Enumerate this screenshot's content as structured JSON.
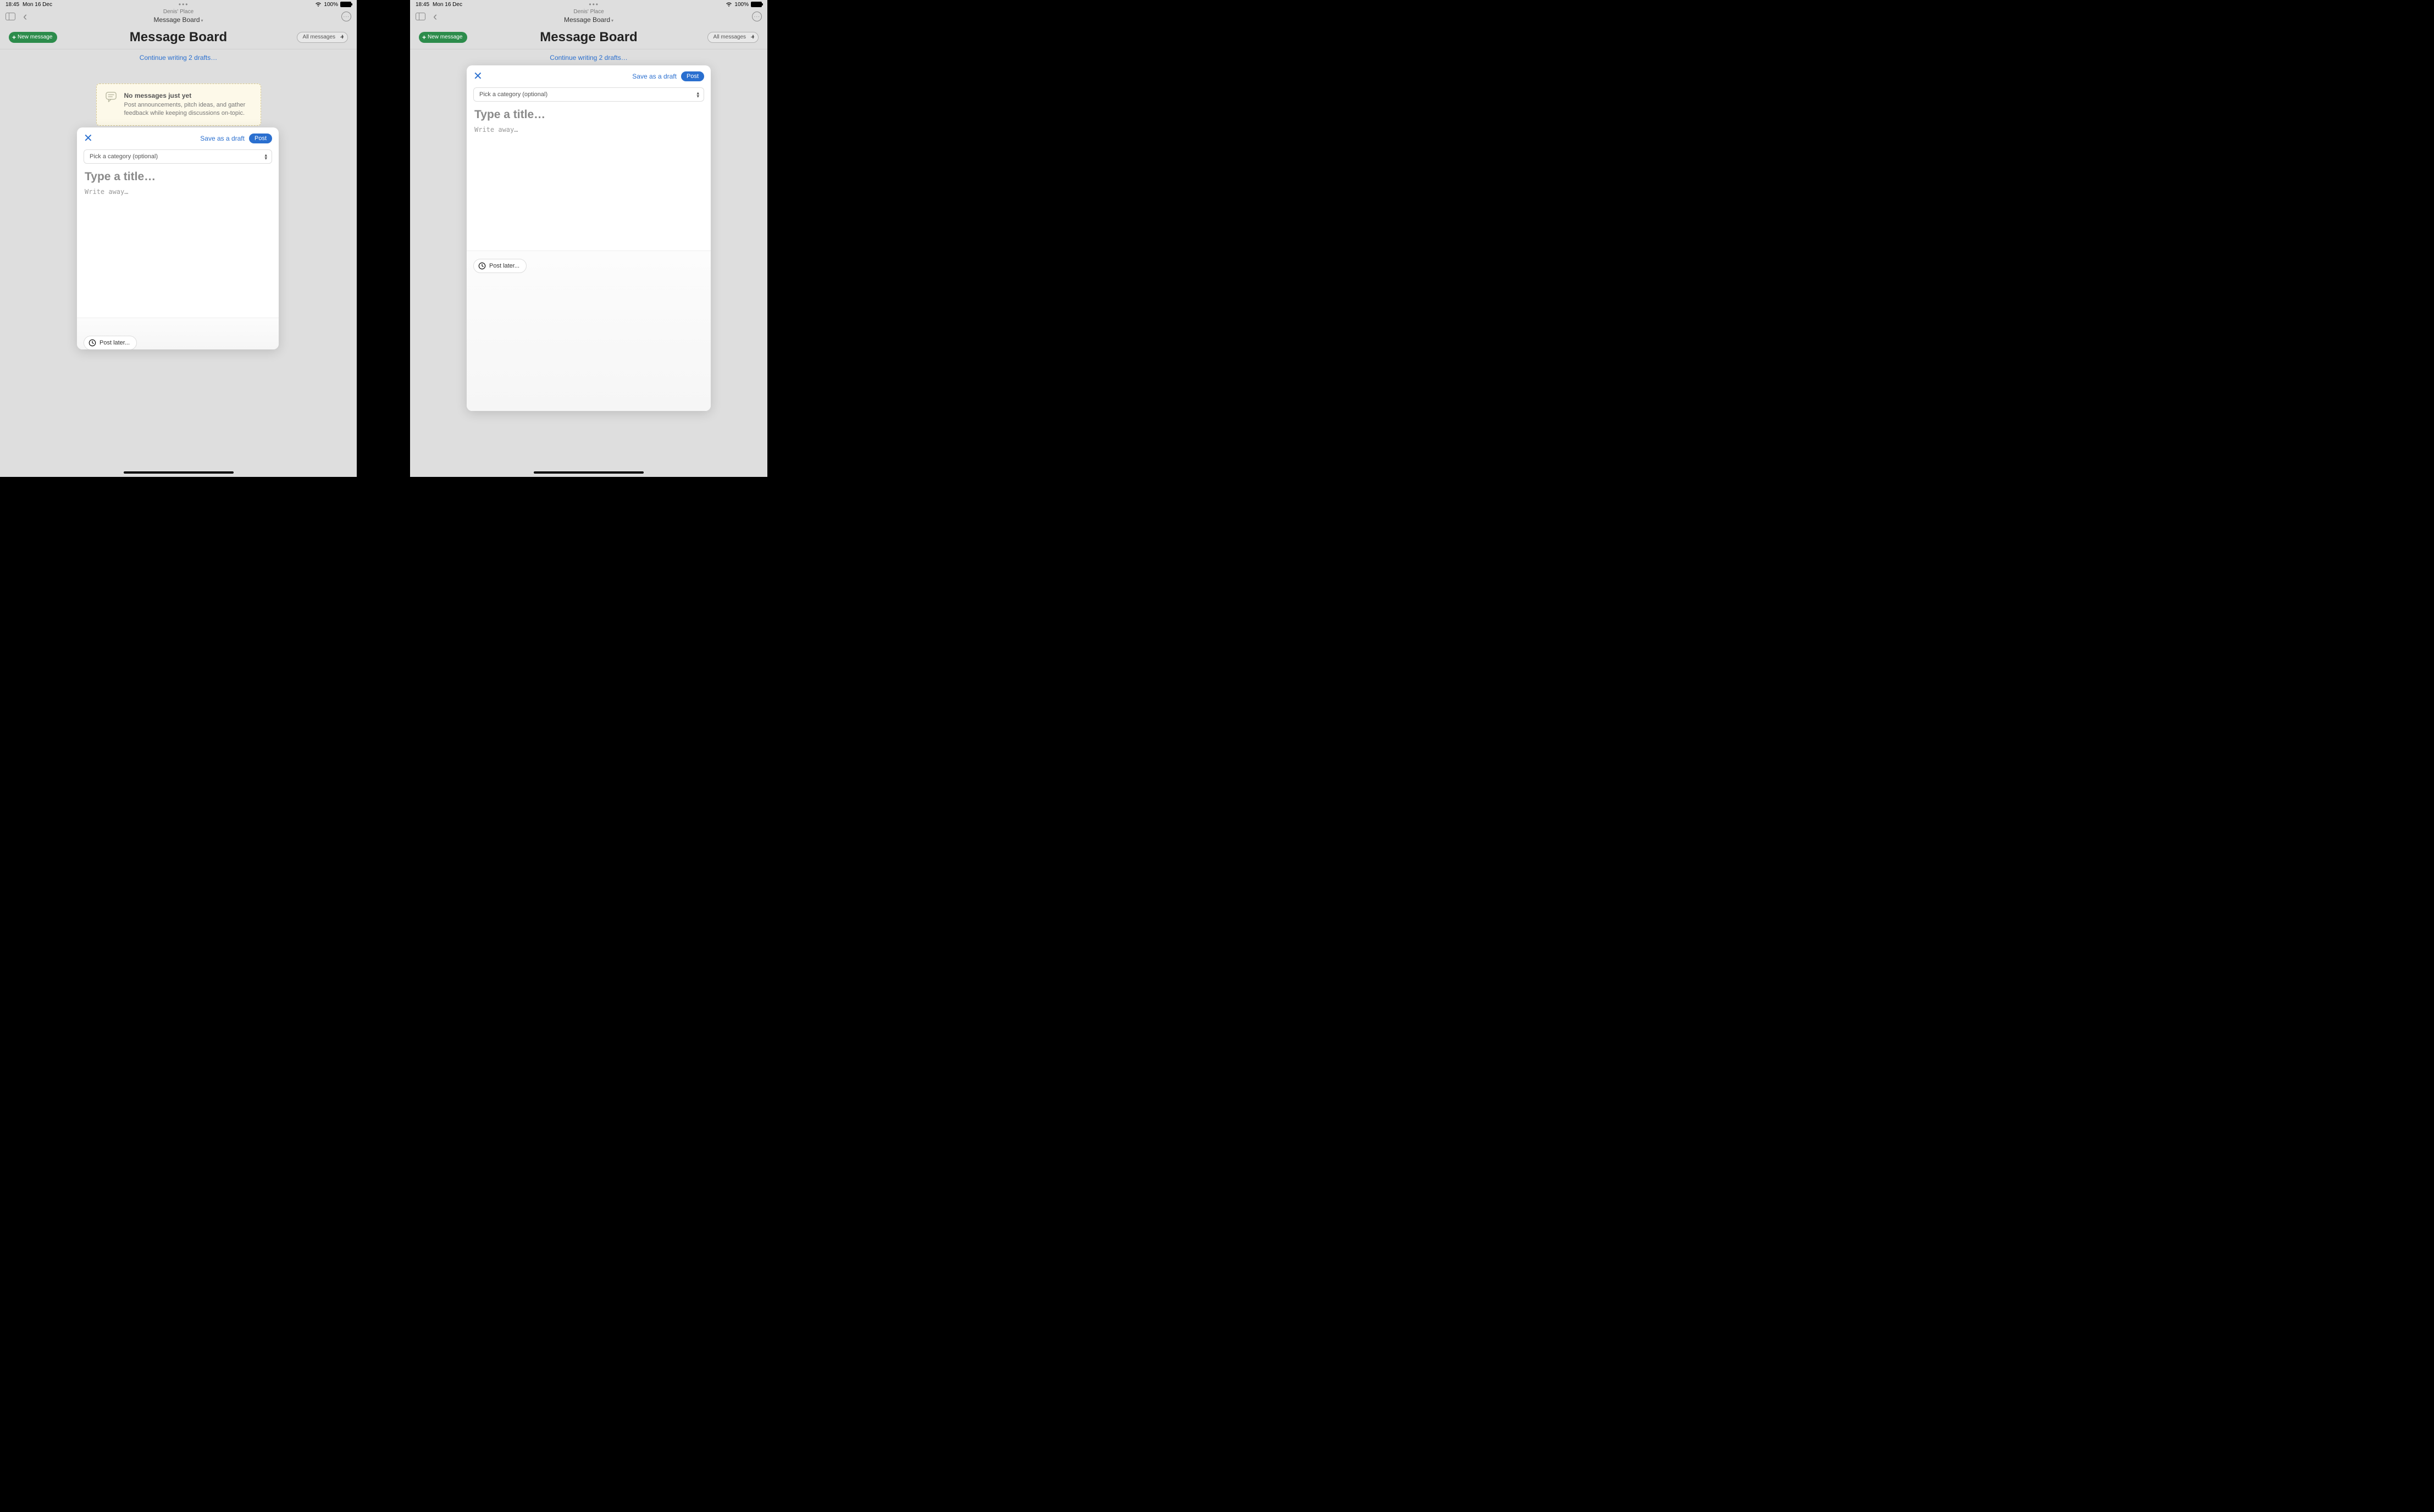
{
  "status": {
    "time": "18:45",
    "date": "Mon 16 Dec",
    "ellipsis": "•••",
    "battery_pct": "100%"
  },
  "nav": {
    "subtitle": "Denis' Place",
    "title": "Message Board",
    "caret": "▾"
  },
  "toolbar": {
    "new_message": "New message",
    "page_title": "Message Board",
    "filter_label": "All messages"
  },
  "drafts_link": "Continue writing 2 drafts…",
  "empty": {
    "title": "No messages just yet",
    "body": "Post announcements, pitch ideas, and gather feedback while keeping discussions on-topic."
  },
  "compose": {
    "save_draft": "Save as a draft",
    "post": "Post",
    "category_placeholder": "Pick a category (optional)",
    "title_placeholder": "Type a title…",
    "body_placeholder": "Write away…",
    "post_later": "Post later..."
  }
}
